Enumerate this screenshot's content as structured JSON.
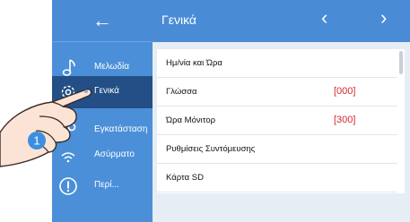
{
  "sidebar": {
    "back_icon": "arrow-left-icon",
    "items": [
      {
        "label": "Μελωδία",
        "icon": "music-note-icon"
      },
      {
        "label": "Γενικά",
        "icon": "gear-icon",
        "active": true
      },
      {
        "label": "Εγκατάσταση",
        "icon": "wrench-icon"
      },
      {
        "label": "Ασύρματο",
        "icon": "wireless-icon"
      },
      {
        "label": "Περί...",
        "icon": "info-icon"
      }
    ]
  },
  "header": {
    "title": "Γενικά",
    "prev_icon": "chevron-left-icon",
    "next_icon": "chevron-right-icon"
  },
  "settings": {
    "rows": [
      {
        "label": "Ημ/νία και Ώρα",
        "value": ""
      },
      {
        "label": "Γλώσσα",
        "value": "[000]"
      },
      {
        "label": "Ώρα Μόνιτορ",
        "value": "[300]"
      },
      {
        "label": "Ρυθμίσεις Συντόμευσης",
        "value": ""
      },
      {
        "label": "Κάρτα SD",
        "value": ""
      }
    ]
  },
  "annotation": {
    "step_number": "1",
    "hand_icon": "pointing-hand-icon"
  },
  "colors": {
    "header_blue": "#4a8bd6",
    "sidebar_blue": "#4b8fd8",
    "active_item": "#234f86",
    "value_red": "#d8262b",
    "step_badge": "#3d8ee0"
  }
}
